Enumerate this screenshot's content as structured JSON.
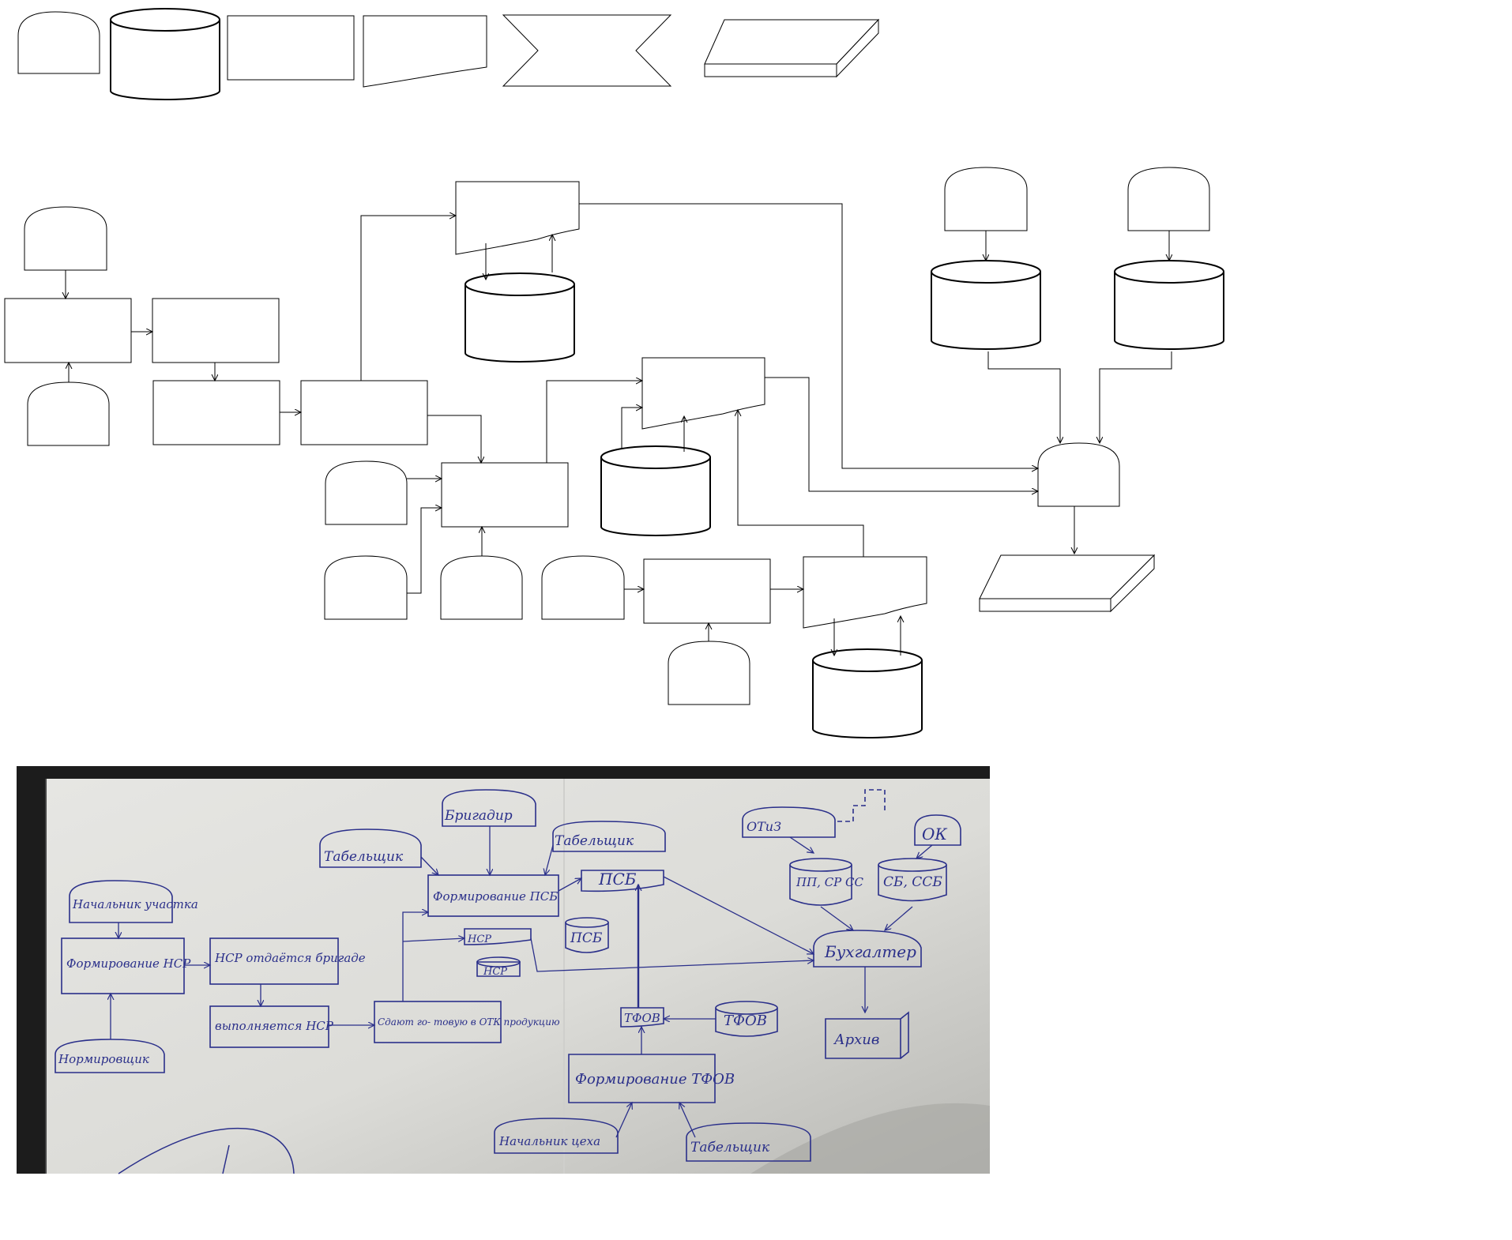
{
  "legend": {
    "shapes": [
      "manual-input-shape",
      "storage-cylinder-shape",
      "process-shape",
      "document-shape",
      "manual-operation-shape",
      "archive-shape"
    ]
  },
  "photo": {
    "labels": {
      "brigadir": "Бригадир",
      "tabelshik_top": "Табельщик",
      "tabelshik_left": "Табельщик",
      "formirovanie_psb": "Формирование ПСБ",
      "psb_doc": "ПСБ",
      "psb_store": "ПСБ",
      "otiz": "ОТиЗ",
      "ok": "ОК",
      "pp_sr": "ПП, СР СС",
      "sb_ssb": "СБ, ССБ",
      "buhgalter": "Бухгалтер",
      "arhiv": "Архив",
      "nachalnik_uchastka": "Начальник участка",
      "formirovanie_ncr": "Формирование НСР",
      "ncr_brigade": "НСР отдаётся бригаде",
      "vypolnyaetsya_ncr": "выполняется НСР",
      "sdayut": "Сдают го- товую в ОТК продукцию",
      "ncr_doc": "НСР",
      "ncr_store": "НСР",
      "normirovshik": "Нормировщик",
      "tfov_doc": "ТФОВ",
      "tfov_store": "ТФОВ",
      "formirovanie_tfov": "Формирование ТФОВ",
      "nachalnik_ceha": "Начальник цеха",
      "tabelshik_bottom": "Табельщик"
    }
  }
}
